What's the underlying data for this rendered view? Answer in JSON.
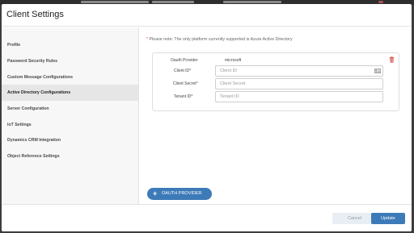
{
  "modal": {
    "title": "Client Settings"
  },
  "sidebar": {
    "items": [
      {
        "label": "Profile"
      },
      {
        "label": "Password Security Rules"
      },
      {
        "label": "Custom Message Configurations"
      },
      {
        "label": "Active Directory Configurations",
        "active": true
      },
      {
        "label": "Server Configuration"
      },
      {
        "label": "IoT Settings"
      },
      {
        "label": "Dynamics CRM Integration"
      },
      {
        "label": "Object Reference Settings"
      }
    ]
  },
  "content": {
    "note_star": "*",
    "note_text": "Please note: The only platform currently supported is Azure Active Directory",
    "provider": {
      "oauth_label": "Oauth Provider",
      "oauth_value": "microsoft",
      "client_id_label": "Client ID*",
      "client_id_placeholder": "Client ID",
      "client_secret_label": "Client Secret*",
      "client_secret_placeholder": "Client Secret",
      "tenant_id_label": "Tenant ID*",
      "tenant_id_placeholder": "Tenant ID"
    },
    "add_button_plus": "+",
    "add_button_label": "OAUTH PROVIDER"
  },
  "footer": {
    "cancel_label": "Cancel",
    "update_label": "Update"
  },
  "colors": {
    "accent": "#3d7ab8",
    "danger": "#d9534f",
    "sidebar_bg": "#f7f7f7",
    "sidebar_active": "#e6e6e6"
  },
  "icons": {
    "delete": "trash-icon",
    "field_helper": "id-card-icon"
  }
}
